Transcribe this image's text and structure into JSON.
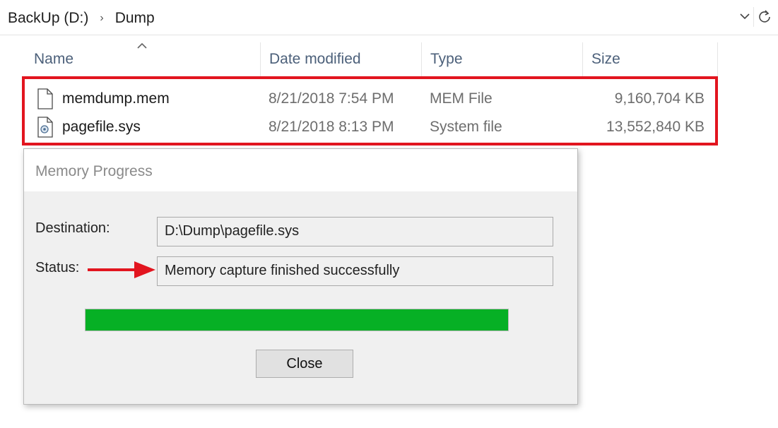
{
  "address_bar": {
    "crumbs": [
      "BackUp (D:)",
      "Dump"
    ],
    "separator": "›"
  },
  "columns": {
    "name": "Name",
    "date": "Date modified",
    "type": "Type",
    "size": "Size"
  },
  "files": [
    {
      "name": "memdump.mem",
      "date": "8/21/2018 7:54 PM",
      "type": "MEM File",
      "size": "9,160,704 KB",
      "icon": "file-icon"
    },
    {
      "name": "pagefile.sys",
      "date": "8/21/2018 8:13 PM",
      "type": "System file",
      "size": "13,552,840 KB",
      "icon": "system-file-icon"
    }
  ],
  "dialog": {
    "title": "Memory Progress",
    "destination_label": "Destination:",
    "destination_value": "D:\\Dump\\pagefile.sys",
    "status_label": "Status:",
    "status_value": "Memory capture finished successfully",
    "progress": 1.0,
    "close_label": "Close"
  },
  "colors": {
    "highlight": "#e2151f",
    "arrow": "#e2151f",
    "progress_fill": "#06b025"
  }
}
